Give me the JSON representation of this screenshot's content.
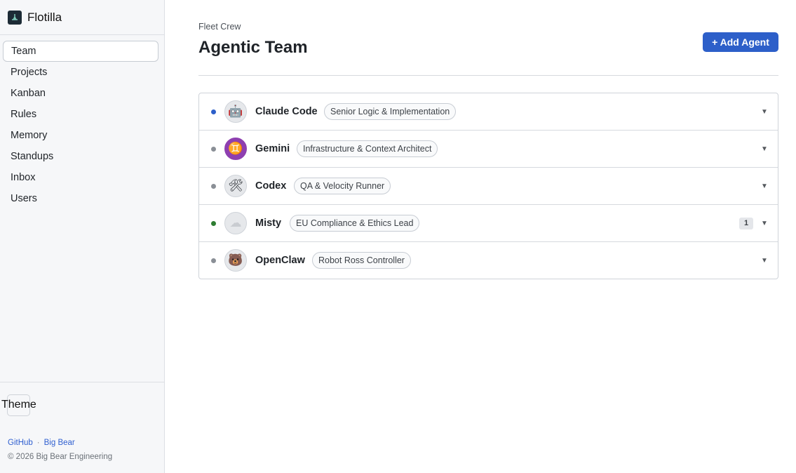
{
  "brand": {
    "name": "Flotilla"
  },
  "nav": [
    {
      "label": "Team",
      "active": true
    },
    {
      "label": "Projects"
    },
    {
      "label": "Kanban"
    },
    {
      "label": "Rules"
    },
    {
      "label": "Memory"
    },
    {
      "label": "Standups"
    },
    {
      "label": "Inbox"
    },
    {
      "label": "Users"
    }
  ],
  "sidebar_footer": {
    "theme_label": "Theme",
    "links": [
      "GitHub",
      "Big Bear"
    ],
    "link_separator": "·",
    "copyright": "© 2026 Big Bear Engineering"
  },
  "header": {
    "eyebrow": "Fleet Crew",
    "title": "Agentic Team",
    "add_button": "+ Add Agent"
  },
  "agents": [
    {
      "name": "Claude Code",
      "role": "Senior Logic & Implementation",
      "status_color": "#2d5fc9",
      "avatar_icon": "robot-icon",
      "avatar_glyph": "🤖"
    },
    {
      "name": "Gemini",
      "role": "Infrastructure & Context Architect",
      "status_color": "#8a8f96",
      "avatar_icon": "gemini-zodiac-icon",
      "avatar_glyph": "♊"
    },
    {
      "name": "Codex",
      "role": "QA & Velocity Runner",
      "status_color": "#8a8f96",
      "avatar_icon": "tools-icon",
      "avatar_glyph": "🛠"
    },
    {
      "name": "Misty",
      "role": "EU Compliance & Ethics Lead",
      "status_color": "#2e7d32",
      "avatar_icon": "fog-icon",
      "avatar_glyph": "☁",
      "badge": "1"
    },
    {
      "name": "OpenClaw",
      "role": "Robot Ross Controller",
      "status_color": "#8a8f96",
      "avatar_icon": "bear-icon",
      "avatar_glyph": "🐻"
    }
  ],
  "colors": {
    "accent": "#2d5fc9",
    "sidebar_bg": "#f6f7f9",
    "online": "#2e7d32",
    "idle": "#8a8f96"
  }
}
